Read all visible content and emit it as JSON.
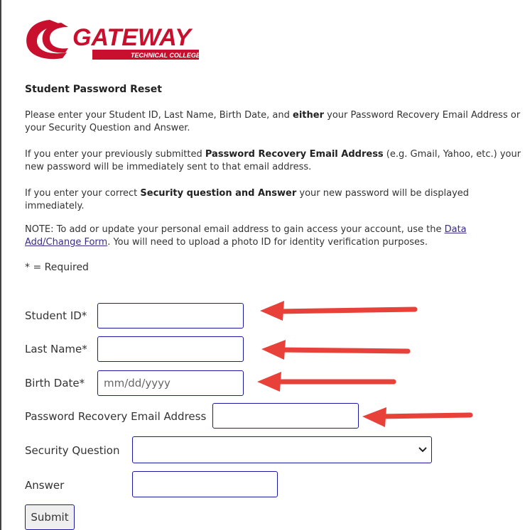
{
  "logo": {
    "brand": "GATEWAY",
    "subtitle": "TECHNICAL COLLEGE"
  },
  "heading": "Student Password Reset",
  "intro": {
    "p1_a": "Please enter your Student ID, Last Name, Birth Date, and ",
    "p1_b": "either",
    "p1_c": " your Password Recovery Email Address or your Security Question and Answer.",
    "p2_a": "If you enter your previously submitted ",
    "p2_b": "Password Recovery Email Address",
    "p2_c": " (e.g. Gmail, Yahoo, etc.) your new password will be immediately sent to that email address.",
    "p3_a": "If you enter your correct ",
    "p3_b": "Security question and Answer",
    "p3_c": " your new password will be displayed immediately.",
    "note_a": "NOTE: To add or update your personal email address to gain access your account, use the ",
    "note_link": "Data Add/Change Form",
    "note_c": ". You will need to upload a photo ID for identity verification purposes."
  },
  "required_note": "* = Required",
  "form": {
    "student_id_label": "Student ID*",
    "student_id_value": "",
    "last_name_label": "Last Name*",
    "last_name_value": "",
    "birth_date_label": "Birth Date*",
    "birth_date_placeholder": "mm/dd/yyyy",
    "email_label": "Password Recovery Email Address",
    "email_value": "",
    "security_question_label": "Security Question",
    "security_question_selected": "",
    "answer_label": "Answer",
    "answer_value": "",
    "submit_label": "Submit"
  },
  "colors": {
    "brand_red": "#c8102e",
    "field_border": "#1a1aa0",
    "annotation_arrow": "#e8413a",
    "link": "#3a2a8a"
  },
  "icons": {
    "select_arrow": "chevron-down-icon",
    "annotation": "arrow-left-icon"
  }
}
